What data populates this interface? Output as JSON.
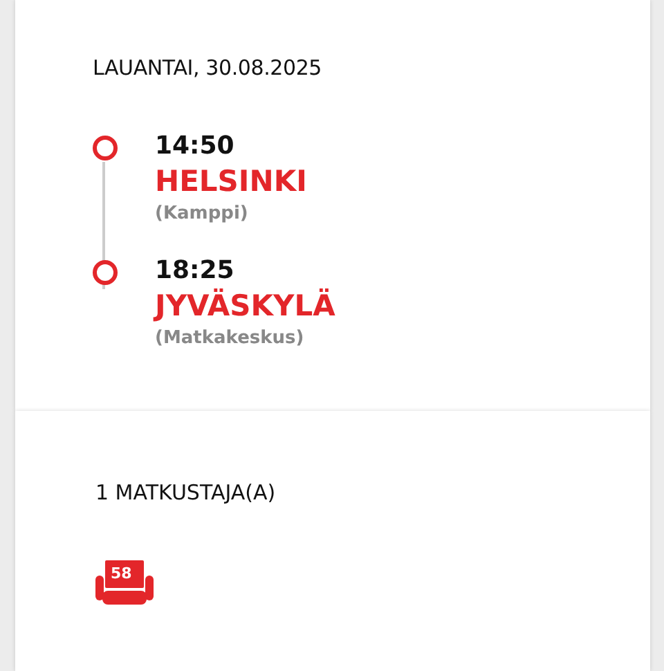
{
  "date": "LAUANTAI, 30.08.2025",
  "stops": [
    {
      "time": "14:50",
      "city": "HELSINKI",
      "station": "(Kamppi)"
    },
    {
      "time": "18:25",
      "city": "JYVÄSKYLÄ",
      "station": "(Matkakeskus)"
    }
  ],
  "passengers": {
    "title": "1 MATKUSTAJA(A)",
    "seats": [
      "58"
    ]
  }
}
